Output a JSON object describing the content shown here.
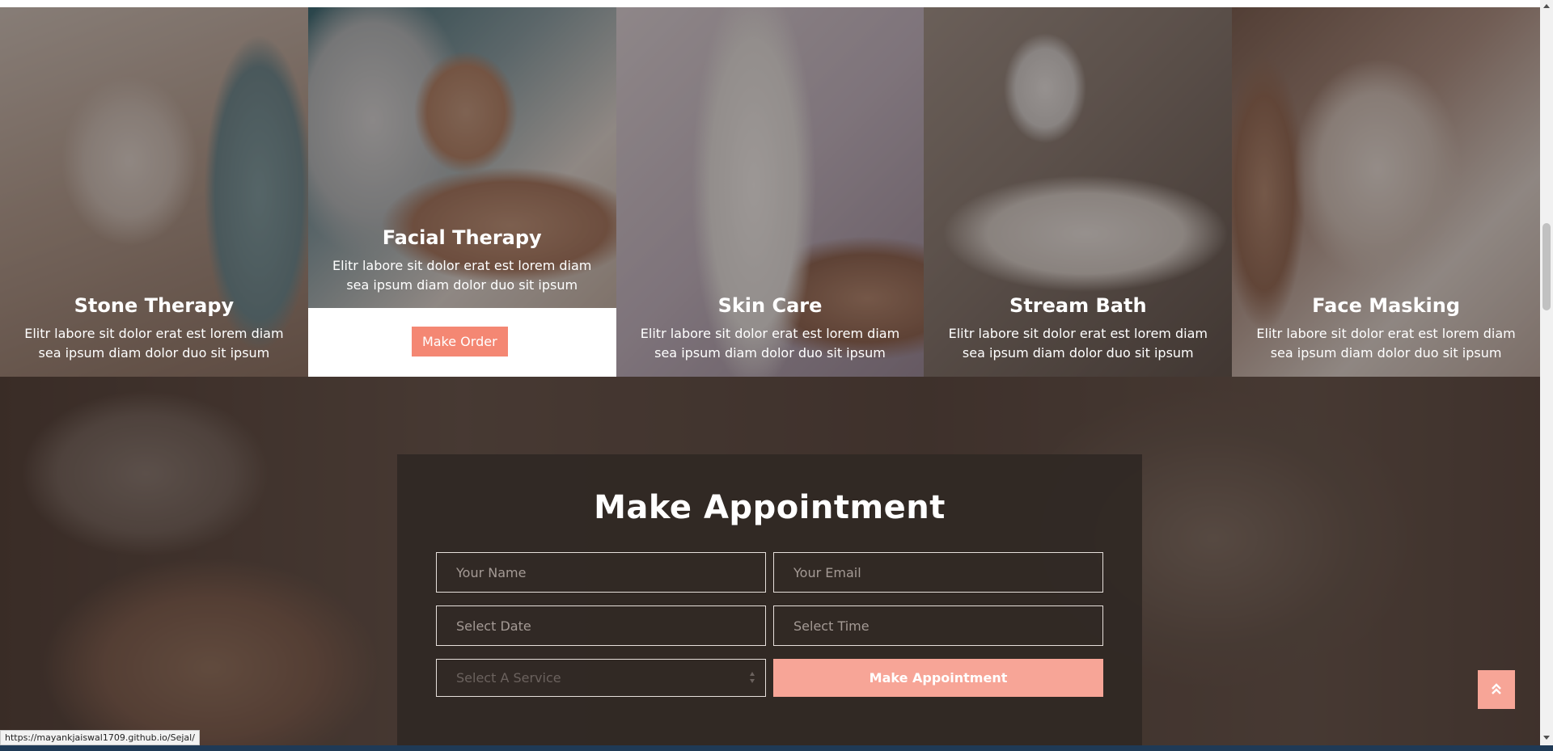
{
  "services": [
    {
      "title": "Stone Therapy",
      "description": "Elitr labore sit dolor erat est lorem diam sea ipsum diam dolor duo sit ipsum"
    },
    {
      "title": "Facial Therapy",
      "description": "Elitr labore sit dolor erat est lorem diam sea ipsum diam dolor duo sit ipsum",
      "button_label": "Make Order"
    },
    {
      "title": "Skin Care",
      "description": "Elitr labore sit dolor erat est lorem diam sea ipsum diam dolor duo sit ipsum"
    },
    {
      "title": "Stream Bath",
      "description": "Elitr labore sit dolor erat est lorem diam sea ipsum diam dolor duo sit ipsum"
    },
    {
      "title": "Face Masking",
      "description": "Elitr labore sit dolor erat est lorem diam sea ipsum diam dolor duo sit ipsum"
    }
  ],
  "appointment": {
    "title": "Make Appointment",
    "name_placeholder": "Your Name",
    "email_placeholder": "Your Email",
    "date_placeholder": "Select Date",
    "time_placeholder": "Select Time",
    "service_selected": "Select A Service",
    "submit_label": "Make Appointment"
  },
  "status_url": "https://mayankjaiswal1709.github.io/Sejal/",
  "colors": {
    "accent": "#f48773",
    "accent_light": "#f7a597",
    "panel": "#302824"
  },
  "icons": {
    "back_to_top": "double-chevron-up-icon",
    "select_arrows": "updown-arrows-icon"
  }
}
